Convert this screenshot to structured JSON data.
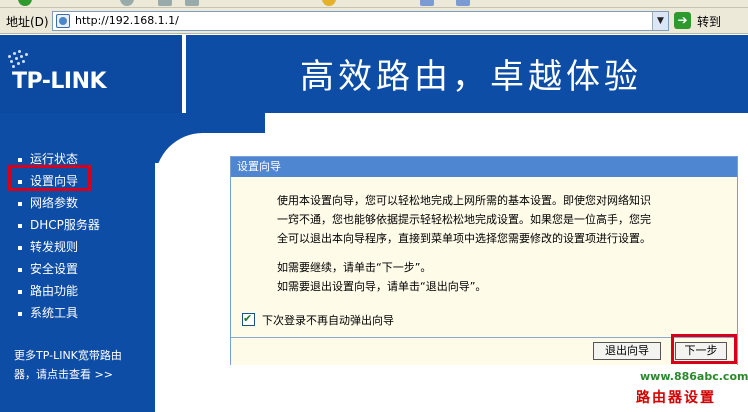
{
  "browser": {
    "address_label": "地址(D)",
    "url": "http://192.168.1.1/",
    "go_label": "转到",
    "icons": [
      "page-icon",
      "dropdown-arrow-icon",
      "go-arrow-icon"
    ]
  },
  "header": {
    "logo_text": "TP-LINK",
    "slogan": "高效路由，卓越体验"
  },
  "sidebar": {
    "items": [
      {
        "label": "运行状态"
      },
      {
        "label": "设置向导"
      },
      {
        "label": "网络参数"
      },
      {
        "label": "DHCP服务器"
      },
      {
        "label": "转发规则"
      },
      {
        "label": "安全设置"
      },
      {
        "label": "路由功能"
      },
      {
        "label": "系统工具"
      }
    ],
    "more_line1": "更多TP-LINK宽带路由",
    "more_line2": "器，请点击查看 >>"
  },
  "panel": {
    "title": "设置向导",
    "lines": [
      "使用本设置向导，您可以轻松地完成上网所需的基本设置。即使您对网络知识",
      "一窍不通，您也能够依据提示轻轻松松地完成设置。如果您是一位高手，您完",
      "全可以退出本向导程序，直接到菜单项中选择您需要修改的设置项进行设置。",
      "如需要继续，请单击“下一步”。",
      "如需要退出设置向导，请单击“退出向导”。"
    ],
    "checkbox_label": "下次登录不再自动弹出向导",
    "checkbox_checked": true,
    "exit_button": "退出向导",
    "next_button": "下一步"
  },
  "watermark": {
    "site": "www.886abc.com",
    "name": "路由器设置"
  },
  "colors": {
    "brand_blue": "#0d4da6",
    "panel_title": "#4f86d1",
    "highlight_red": "#d6001c"
  }
}
